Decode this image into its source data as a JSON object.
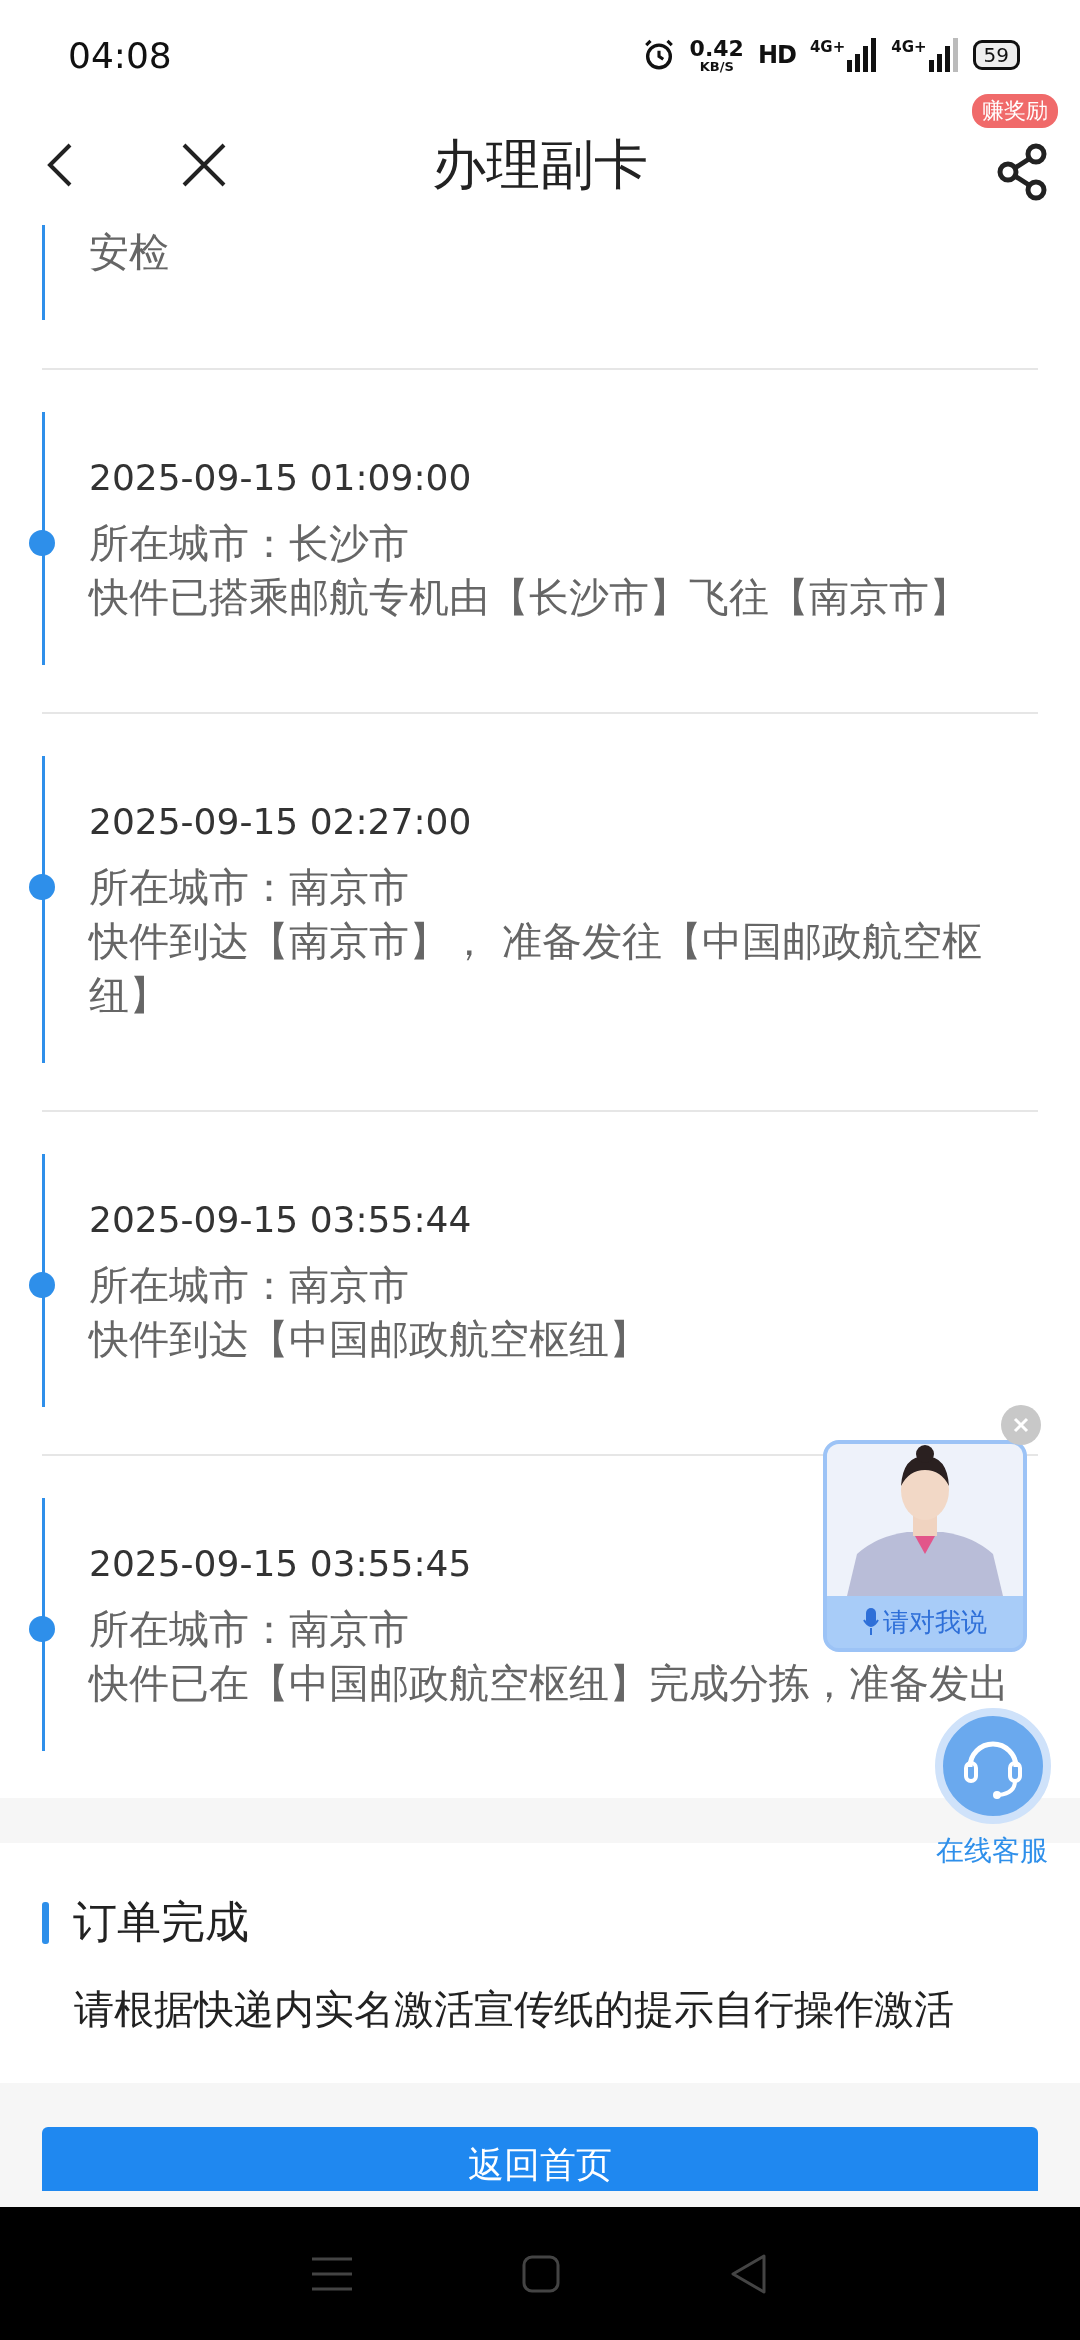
{
  "status_bar": {
    "time": "04:08",
    "speed": "0.42",
    "speed_unit": "KB/S",
    "hd": "HD",
    "networks": [
      "4G+",
      "4G+"
    ],
    "battery": "59"
  },
  "header": {
    "title": "办理副卡",
    "reward_badge": "赚奖励"
  },
  "partial_item": {
    "text": "安检"
  },
  "tracking": [
    {
      "time": "2025-09-15 01:09:00",
      "city": "所在城市：长沙市",
      "detail": "快件已搭乘邮航专机由【长沙市】飞往【南京市】"
    },
    {
      "time": "2025-09-15 02:27:00",
      "city": "所在城市：南京市",
      "detail": "快件到达【南京市】， 准备发往【中国邮政航空枢纽】"
    },
    {
      "time": "2025-09-15 03:55:44",
      "city": "所在城市：南京市",
      "detail": "快件到达【中国邮政航空枢纽】"
    },
    {
      "time": "2025-09-15 03:55:45",
      "city": "所在城市：南京市",
      "detail": "快件已在【中国邮政航空枢纽】完成分拣，准备发出"
    }
  ],
  "order": {
    "title": "订单完成",
    "description": "请根据快递内实名激活宣传纸的提示自行操作激活"
  },
  "home_button": "返回首页",
  "assistant": {
    "prompt": "请对我说"
  },
  "support": {
    "label": "在线客服"
  }
}
